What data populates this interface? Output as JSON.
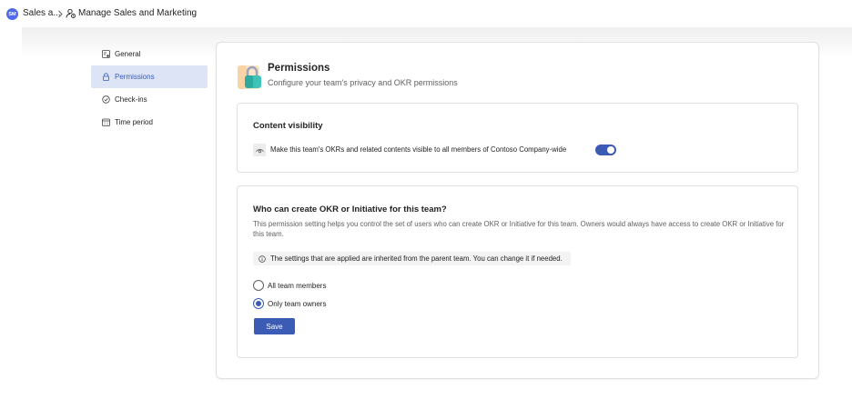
{
  "breadcrumb": {
    "avatar_initials": "SM",
    "parent": "Sales a...",
    "current": "Manage Sales and Marketing"
  },
  "nav": {
    "items": [
      {
        "label": "General",
        "icon": "settings-icon",
        "active": false
      },
      {
        "label": "Permissions",
        "icon": "lock-icon",
        "active": true
      },
      {
        "label": "Check-ins",
        "icon": "check-circle-icon",
        "active": false
      },
      {
        "label": "Time period",
        "icon": "calendar-icon",
        "active": false
      }
    ]
  },
  "header": {
    "title": "Permissions",
    "subtitle": "Configure your team's privacy and OKR permissions"
  },
  "visibility": {
    "title": "Content visibility",
    "text": "Make this team's OKRs and related contents visible to all members of Contoso Company-wide",
    "enabled": true
  },
  "create": {
    "title": "Who can create OKR or Initiative for this team?",
    "description": "This permission setting helps you control the set of users who can create OKR or Initiative for this team. Owners would always have access to create OKR or Initiative for this team.",
    "info": "The settings that are applied are inherited from the parent team. You can change it if needed.",
    "options": [
      {
        "label": "All team members",
        "checked": false
      },
      {
        "label": "Only team owners",
        "checked": true
      }
    ],
    "save_label": "Save"
  },
  "colors": {
    "accent": "#3b5bb5",
    "active_nav_bg": "#dce4f5"
  }
}
